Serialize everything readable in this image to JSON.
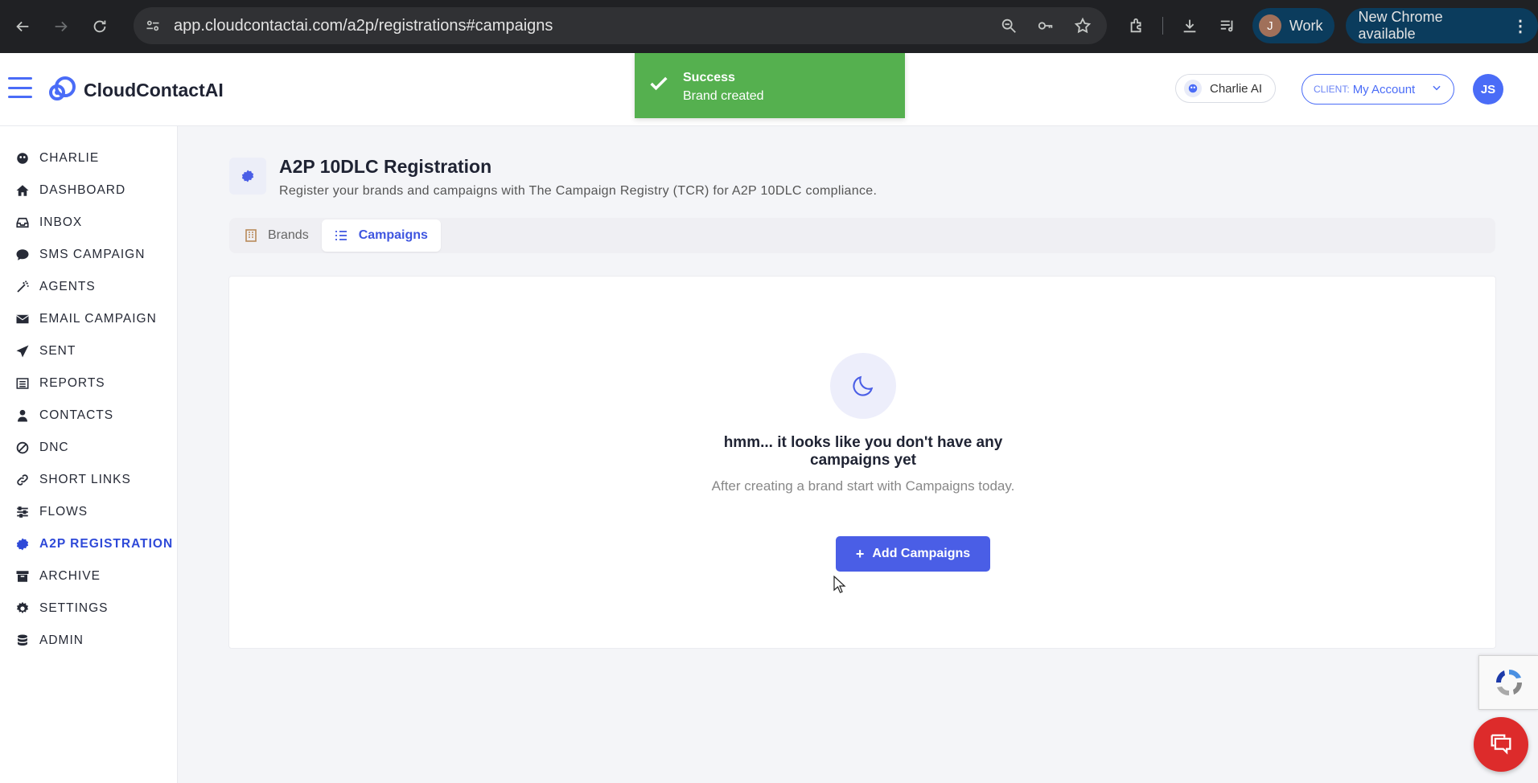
{
  "browser": {
    "url": "app.cloudcontactai.com/a2p/registrations#campaigns",
    "profile_initial": "J",
    "profile_name": "Work",
    "update_label": "New Chrome available"
  },
  "header": {
    "logo_text": "CloudContactAI",
    "charlie_label": "Charlie AI",
    "client_prefix": "CLIENT:",
    "client_name": "My Account",
    "user_initials": "JS"
  },
  "toast": {
    "title": "Success",
    "message": "Brand created",
    "color": "#55b04f"
  },
  "sidebar": {
    "items": [
      {
        "label": "CHARLIE",
        "icon": "charlie-icon"
      },
      {
        "label": "DASHBOARD",
        "icon": "home-icon"
      },
      {
        "label": "INBOX",
        "icon": "inbox-icon"
      },
      {
        "label": "SMS CAMPAIGN",
        "icon": "chat-bubble-icon"
      },
      {
        "label": "AGENTS",
        "icon": "magic-wand-icon"
      },
      {
        "label": "EMAIL CAMPAIGN",
        "icon": "envelope-icon"
      },
      {
        "label": "SENT",
        "icon": "paper-plane-icon"
      },
      {
        "label": "REPORTS",
        "icon": "list-icon"
      },
      {
        "label": "CONTACTS",
        "icon": "user-icon"
      },
      {
        "label": "DNC",
        "icon": "ban-icon"
      },
      {
        "label": "SHORT LINKS",
        "icon": "link-icon"
      },
      {
        "label": "FLOWS",
        "icon": "sliders-icon"
      },
      {
        "label": "A2P REGISTRATION",
        "icon": "badge-icon",
        "active": true
      },
      {
        "label": "ARCHIVE",
        "icon": "archive-icon"
      },
      {
        "label": "SETTINGS",
        "icon": "gear-icon"
      },
      {
        "label": "ADMIN",
        "icon": "database-icon"
      }
    ]
  },
  "page": {
    "title": "A2P 10DLC Registration",
    "subtitle": "Register your brands and campaigns with The Campaign Registry (TCR) for A2P 10DLC compliance.",
    "tabs": [
      {
        "label": "Brands",
        "icon": "building-icon"
      },
      {
        "label": "Campaigns",
        "icon": "list-icon",
        "active": true
      }
    ]
  },
  "empty_state": {
    "icon": "moon-icon",
    "title": "hmm... it looks like you don't have any campaigns yet",
    "subtitle": "After creating a brand start with Campaigns today.",
    "button_label": "Add Campaigns"
  },
  "colors": {
    "accent": "#4a5ee6",
    "active_nav": "#2e49d8",
    "chat": "#dd2b2b"
  }
}
